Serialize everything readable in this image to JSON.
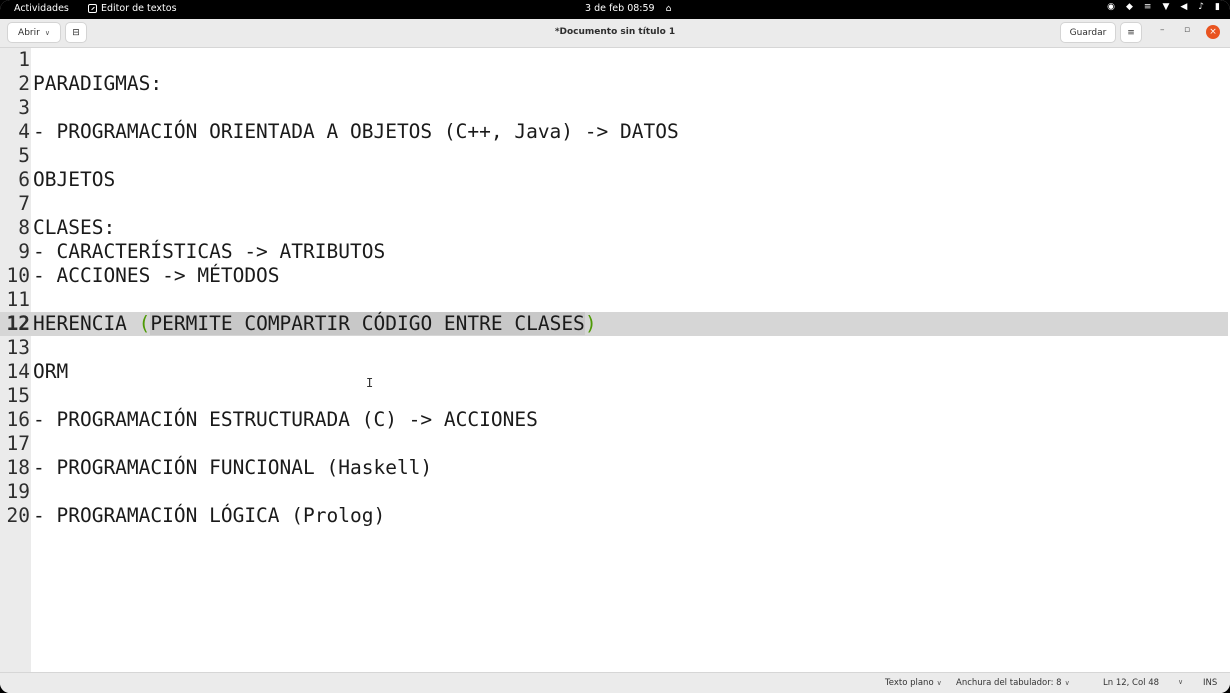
{
  "topbar": {
    "activities": "Actividades",
    "app_name": "Editor de textos",
    "clock": "3 de feb  08:59"
  },
  "header": {
    "open_label": "Abrir",
    "title": "*Documento sin título 1",
    "save_label": "Guardar"
  },
  "editor": {
    "lines": [
      {
        "n": "1",
        "text": ""
      },
      {
        "n": "2",
        "text": "PARADIGMAS:"
      },
      {
        "n": "3",
        "text": ""
      },
      {
        "n": "4",
        "text": "- PROGRAMACIÓN ORIENTADA A OBJETOS (C++, Java) -> DATOS"
      },
      {
        "n": "5",
        "text": ""
      },
      {
        "n": "6",
        "text": "OBJETOS"
      },
      {
        "n": "7",
        "text": ""
      },
      {
        "n": "8",
        "text": "CLASES:"
      },
      {
        "n": "9",
        "text": "- CARACTERÍSTICAS -> ATRIBUTOS"
      },
      {
        "n": "10",
        "text": "- ACCIONES -> MÉTODOS"
      },
      {
        "n": "11",
        "text": ""
      },
      {
        "n": "12",
        "text": ""
      },
      {
        "n": "13",
        "text": ""
      },
      {
        "n": "14",
        "text": "ORM"
      },
      {
        "n": "15",
        "text": ""
      },
      {
        "n": "16",
        "text": "- PROGRAMACIÓN ESTRUCTURADA (C) -> ACCIONES"
      },
      {
        "n": "17",
        "text": ""
      },
      {
        "n": "18",
        "text": "- PROGRAMACIÓN FUNCIONAL (Haskell)"
      },
      {
        "n": "19",
        "text": ""
      },
      {
        "n": "20",
        "text": "- PROGRAMACIÓN LÓGICA (Prolog)"
      }
    ],
    "current_line": {
      "n": "12",
      "before": "HERENCIA ",
      "open_paren": "(",
      "selected": "PERMITE COMPARTIR CÓDIGO ENTRE CLASES",
      "close_paren": ")"
    }
  },
  "statusbar": {
    "language": "Texto plano",
    "tab_width": "Anchura del tabulador: 8",
    "position": "Ln 12, Col 48",
    "mode": "INS"
  },
  "colors": {
    "accent_close": "#e95420",
    "bracket_match": "#4e9a06",
    "current_line_bg": "#d6d6d6"
  }
}
